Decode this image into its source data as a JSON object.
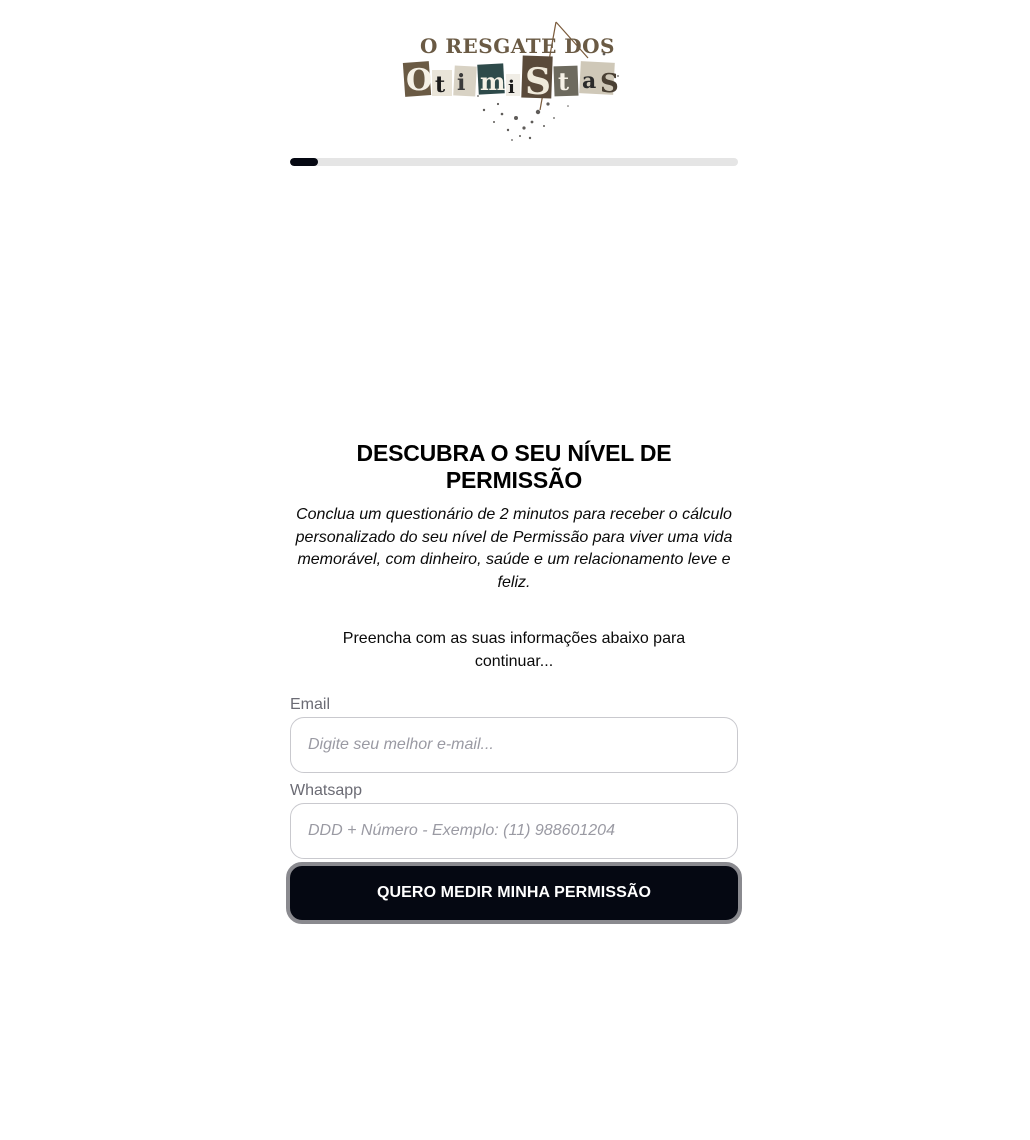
{
  "logo": {
    "line1": "O RESGATE DOS",
    "line2": "OtimiStas"
  },
  "progress": {
    "percent": 6.25,
    "color": "#050812"
  },
  "hero": {
    "headline": "DESCUBRA O SEU NÍVEL DE PERMISSÃO",
    "subhead": "Conclua um questionário de 2 minutos para receber o cálculo personalizado do seu nível de Permissão para viver uma vida memorável, com dinheiro, saúde e um relacionamento leve e feliz.",
    "instruction": "Preencha com as suas informações abaixo para continuar..."
  },
  "form": {
    "email_label": "Email",
    "email_placeholder": "Digite seu melhor e-mail...",
    "email_value": "",
    "whatsapp_label": "Whatsapp",
    "whatsapp_placeholder": "DDD + Número - Exemplo: (11) 988601204",
    "whatsapp_value": "",
    "submit_label": "QUERO MEDIR MINHA PERMISSÃO"
  },
  "colors": {
    "button_bg": "#050812",
    "button_border": "#8a8a8f",
    "track": "#e5e5e5"
  }
}
